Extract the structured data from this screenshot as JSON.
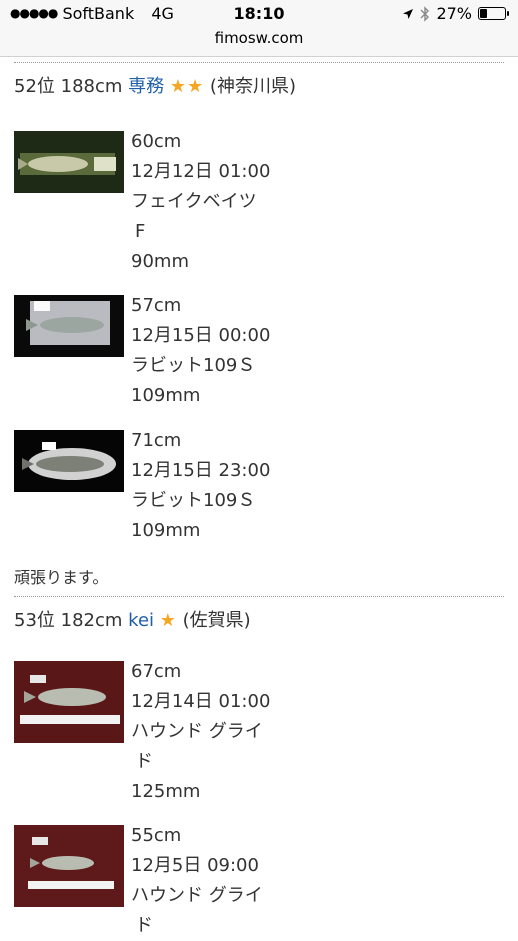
{
  "status_bar": {
    "carrier": "SoftBank",
    "network": "4G",
    "time": "18:10",
    "battery_percent": "27%",
    "battery_level": 0.27,
    "url": "fimosw.com"
  },
  "entries": [
    {
      "rank": "52位",
      "total": "188cm",
      "user": "専務",
      "stars": "★★",
      "region": "(神奈川県)",
      "catches": [
        {
          "size": "60cm",
          "datetime": "12月12日 01:00",
          "lure": "フェイクベイツ",
          "lure2": "F",
          "lure_size": "90mm",
          "photo": "fish-photo-dark-green"
        },
        {
          "size": "57cm",
          "datetime": "12月15日 00:00",
          "lure": "ラビット109Ｓ",
          "lure2": "",
          "lure_size": "109mm",
          "photo": "fish-photo-night-board"
        },
        {
          "size": "71cm",
          "datetime": "12月15日 23:00",
          "lure": "ラビット109Ｓ",
          "lure2": "",
          "lure_size": "109mm",
          "photo": "fish-photo-night-lit"
        }
      ],
      "comment": "頑張ります。"
    },
    {
      "rank": "53位",
      "total": "182cm",
      "user": "kei",
      "stars": "★",
      "region": "(佐賀県)",
      "catches": [
        {
          "size": "67cm",
          "datetime": "12月14日 01:00",
          "lure": "ハウンド グライ",
          "lure2": "ド",
          "lure_size": "125mm",
          "photo": "fish-photo-red-mat"
        },
        {
          "size": "55cm",
          "datetime": "12月5日 09:00",
          "lure": "ハウンド グライ",
          "lure2": "ド",
          "lure_size": "",
          "photo": "fish-photo-red-mat"
        }
      ]
    }
  ]
}
